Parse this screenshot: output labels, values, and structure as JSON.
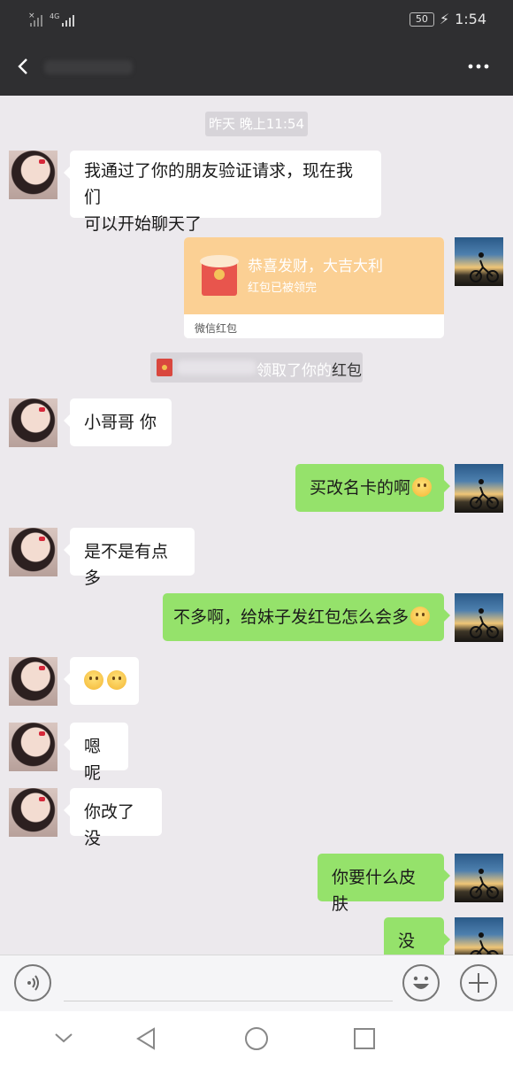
{
  "status_bar": {
    "battery": "50",
    "time": "1:54",
    "network": "4G"
  },
  "chat": {
    "timestamp": "昨天 晚上11:54",
    "messages": [
      {
        "side": "left",
        "lines": [
          "我通过了你的朋友验证请求，现在我们",
          "可以开始聊天了"
        ]
      },
      {
        "side": "right",
        "type": "red_packet",
        "title": "恭喜发财，大吉大利",
        "status": "红包已被领完",
        "footer": "微信红包"
      },
      {
        "side": "system",
        "text_suffix": "领取了你的",
        "text_highlight": "红包"
      },
      {
        "side": "left",
        "text": "小哥哥  你"
      },
      {
        "side": "right",
        "text": "买改名卡的啊",
        "emoji": "laughing-tears-emoji"
      },
      {
        "side": "left",
        "text": "是不是有点多"
      },
      {
        "side": "right",
        "text": "不多啊，给妹子发红包怎么会多",
        "emoji": "flushed-emoji"
      },
      {
        "side": "left",
        "emoji_only": [
          "smile-emoji",
          "smile-emoji"
        ]
      },
      {
        "side": "left",
        "text": "嗯呢"
      },
      {
        "side": "left",
        "text": "你改了没"
      },
      {
        "side": "right",
        "text": "你要什么皮肤"
      },
      {
        "side": "right",
        "text": "没有"
      }
    ]
  },
  "colors": {
    "header_bg": "#2f2f31",
    "chat_bg": "#ece9ed",
    "bubble_self": "#95e26b",
    "bubble_other": "#ffffff",
    "red_packet": "#fbd094"
  },
  "icons": [
    "back-arrow-icon",
    "more-icon",
    "voice-icon",
    "emoji-icon",
    "plus-icon",
    "nav-down-icon",
    "nav-back-icon",
    "nav-home-icon",
    "nav-recent-icon"
  ]
}
